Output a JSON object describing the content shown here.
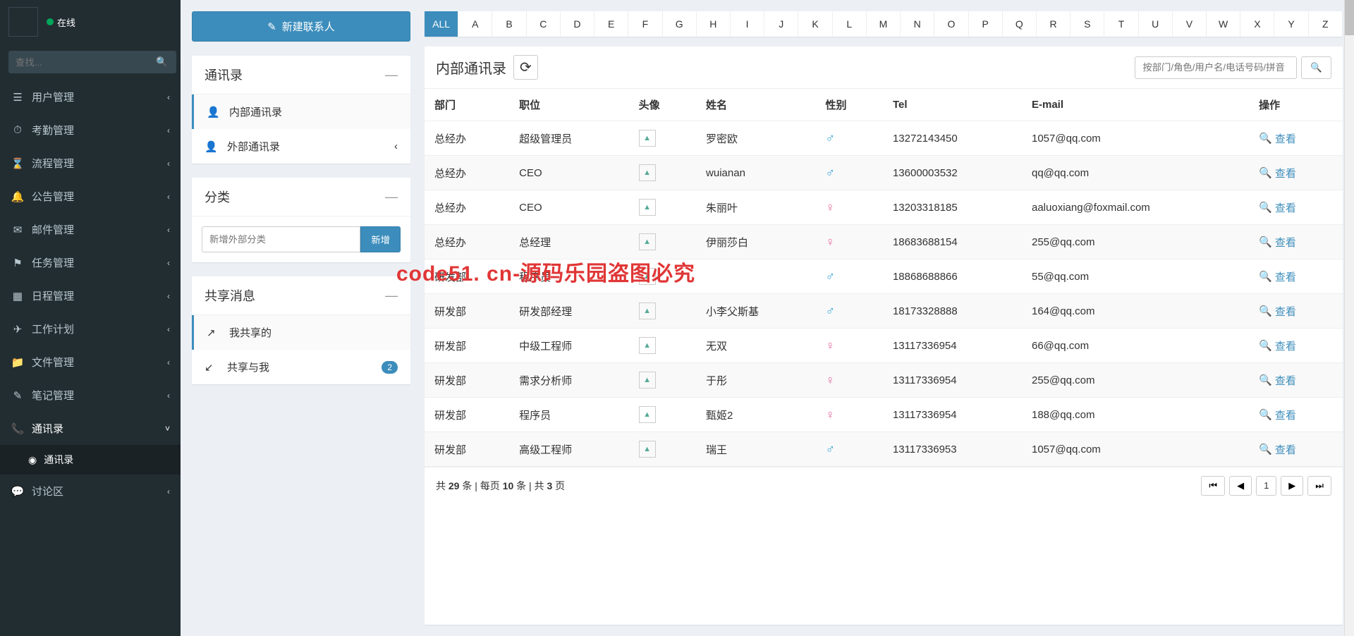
{
  "user": {
    "status": "在线"
  },
  "search_placeholder": "查找...",
  "sidebar_menu": [
    {
      "icon": "☰",
      "label": "用户管理"
    },
    {
      "icon": "⏱",
      "label": "考勤管理"
    },
    {
      "icon": "⌛",
      "label": "流程管理"
    },
    {
      "icon": "🔔",
      "label": "公告管理"
    },
    {
      "icon": "✉",
      "label": "邮件管理"
    },
    {
      "icon": "⚑",
      "label": "任务管理"
    },
    {
      "icon": "▦",
      "label": "日程管理"
    },
    {
      "icon": "✈",
      "label": "工作计划"
    },
    {
      "icon": "📁",
      "label": "文件管理"
    },
    {
      "icon": "✎",
      "label": "笔记管理"
    },
    {
      "icon": "📞",
      "label": "通讯录",
      "open": true
    },
    {
      "icon": "💬",
      "label": "讨论区"
    }
  ],
  "submenu_label": "通讯录",
  "new_contact_label": "新建联系人",
  "panels": {
    "addressbook": {
      "title": "通讯录",
      "items": [
        {
          "label": "内部通讯录",
          "active": true
        },
        {
          "label": "外部通讯录",
          "chev": "‹"
        }
      ]
    },
    "category": {
      "title": "分类",
      "input_placeholder": "新增外部分类",
      "btn": "新增"
    },
    "share": {
      "title": "共享消息",
      "items": [
        {
          "label": "我共享的",
          "active": true
        },
        {
          "label": "共享与我",
          "badge": "2"
        }
      ]
    }
  },
  "alpha": [
    "ALL",
    "A",
    "B",
    "C",
    "D",
    "E",
    "F",
    "G",
    "H",
    "I",
    "J",
    "K",
    "L",
    "M",
    "N",
    "O",
    "P",
    "Q",
    "R",
    "S",
    "T",
    "U",
    "V",
    "W",
    "X",
    "Y",
    "Z"
  ],
  "table": {
    "title": "内部通讯录",
    "search_placeholder": "按部门/角色/用户名/电话号码/拼音",
    "columns": [
      "部门",
      "职位",
      "头像",
      "姓名",
      "性别",
      "Tel",
      "E-mail",
      "操作"
    ],
    "view_label": "查看",
    "rows": [
      {
        "dept": "总经办",
        "role": "超级管理员",
        "name": "罗密欧",
        "gender": "m",
        "tel": "13272143450",
        "email": "1057@qq.com"
      },
      {
        "dept": "总经办",
        "role": "CEO",
        "name": "wuianan",
        "gender": "m",
        "tel": "13600003532",
        "email": "qq@qq.com"
      },
      {
        "dept": "总经办",
        "role": "CEO",
        "name": "朱丽叶",
        "gender": "f",
        "tel": "13203318185",
        "email": "aaluoxiang@foxmail.com"
      },
      {
        "dept": "总经办",
        "role": "总经理",
        "name": "伊丽莎白",
        "gender": "f",
        "tel": "18683688154",
        "email": "255@qq.com"
      },
      {
        "dept": "研发部",
        "role": "程序员",
        "name": "",
        "gender": "m",
        "tel": "18868688866",
        "email": "55@qq.com"
      },
      {
        "dept": "研发部",
        "role": "研发部经理",
        "name": "小李父斯基",
        "gender": "m",
        "tel": "18173328888",
        "email": "164@qq.com"
      },
      {
        "dept": "研发部",
        "role": "中级工程师",
        "name": "无双",
        "gender": "f",
        "tel": "13117336954",
        "email": "66@qq.com"
      },
      {
        "dept": "研发部",
        "role": "需求分析师",
        "name": "于彤",
        "gender": "f",
        "tel": "13117336954",
        "email": "255@qq.com"
      },
      {
        "dept": "研发部",
        "role": "程序员",
        "name": "甄姬2",
        "gender": "f",
        "tel": "13117336954",
        "email": "188@qq.com"
      },
      {
        "dept": "研发部",
        "role": "高级工程师",
        "name": "瑞王",
        "gender": "m",
        "tel": "13117336953",
        "email": "1057@qq.com"
      }
    ],
    "pagination": {
      "total": 29,
      "per_page": 10,
      "pages": 3,
      "current": 1
    }
  },
  "watermark": "code51. cn-源码乐园盗图必究"
}
